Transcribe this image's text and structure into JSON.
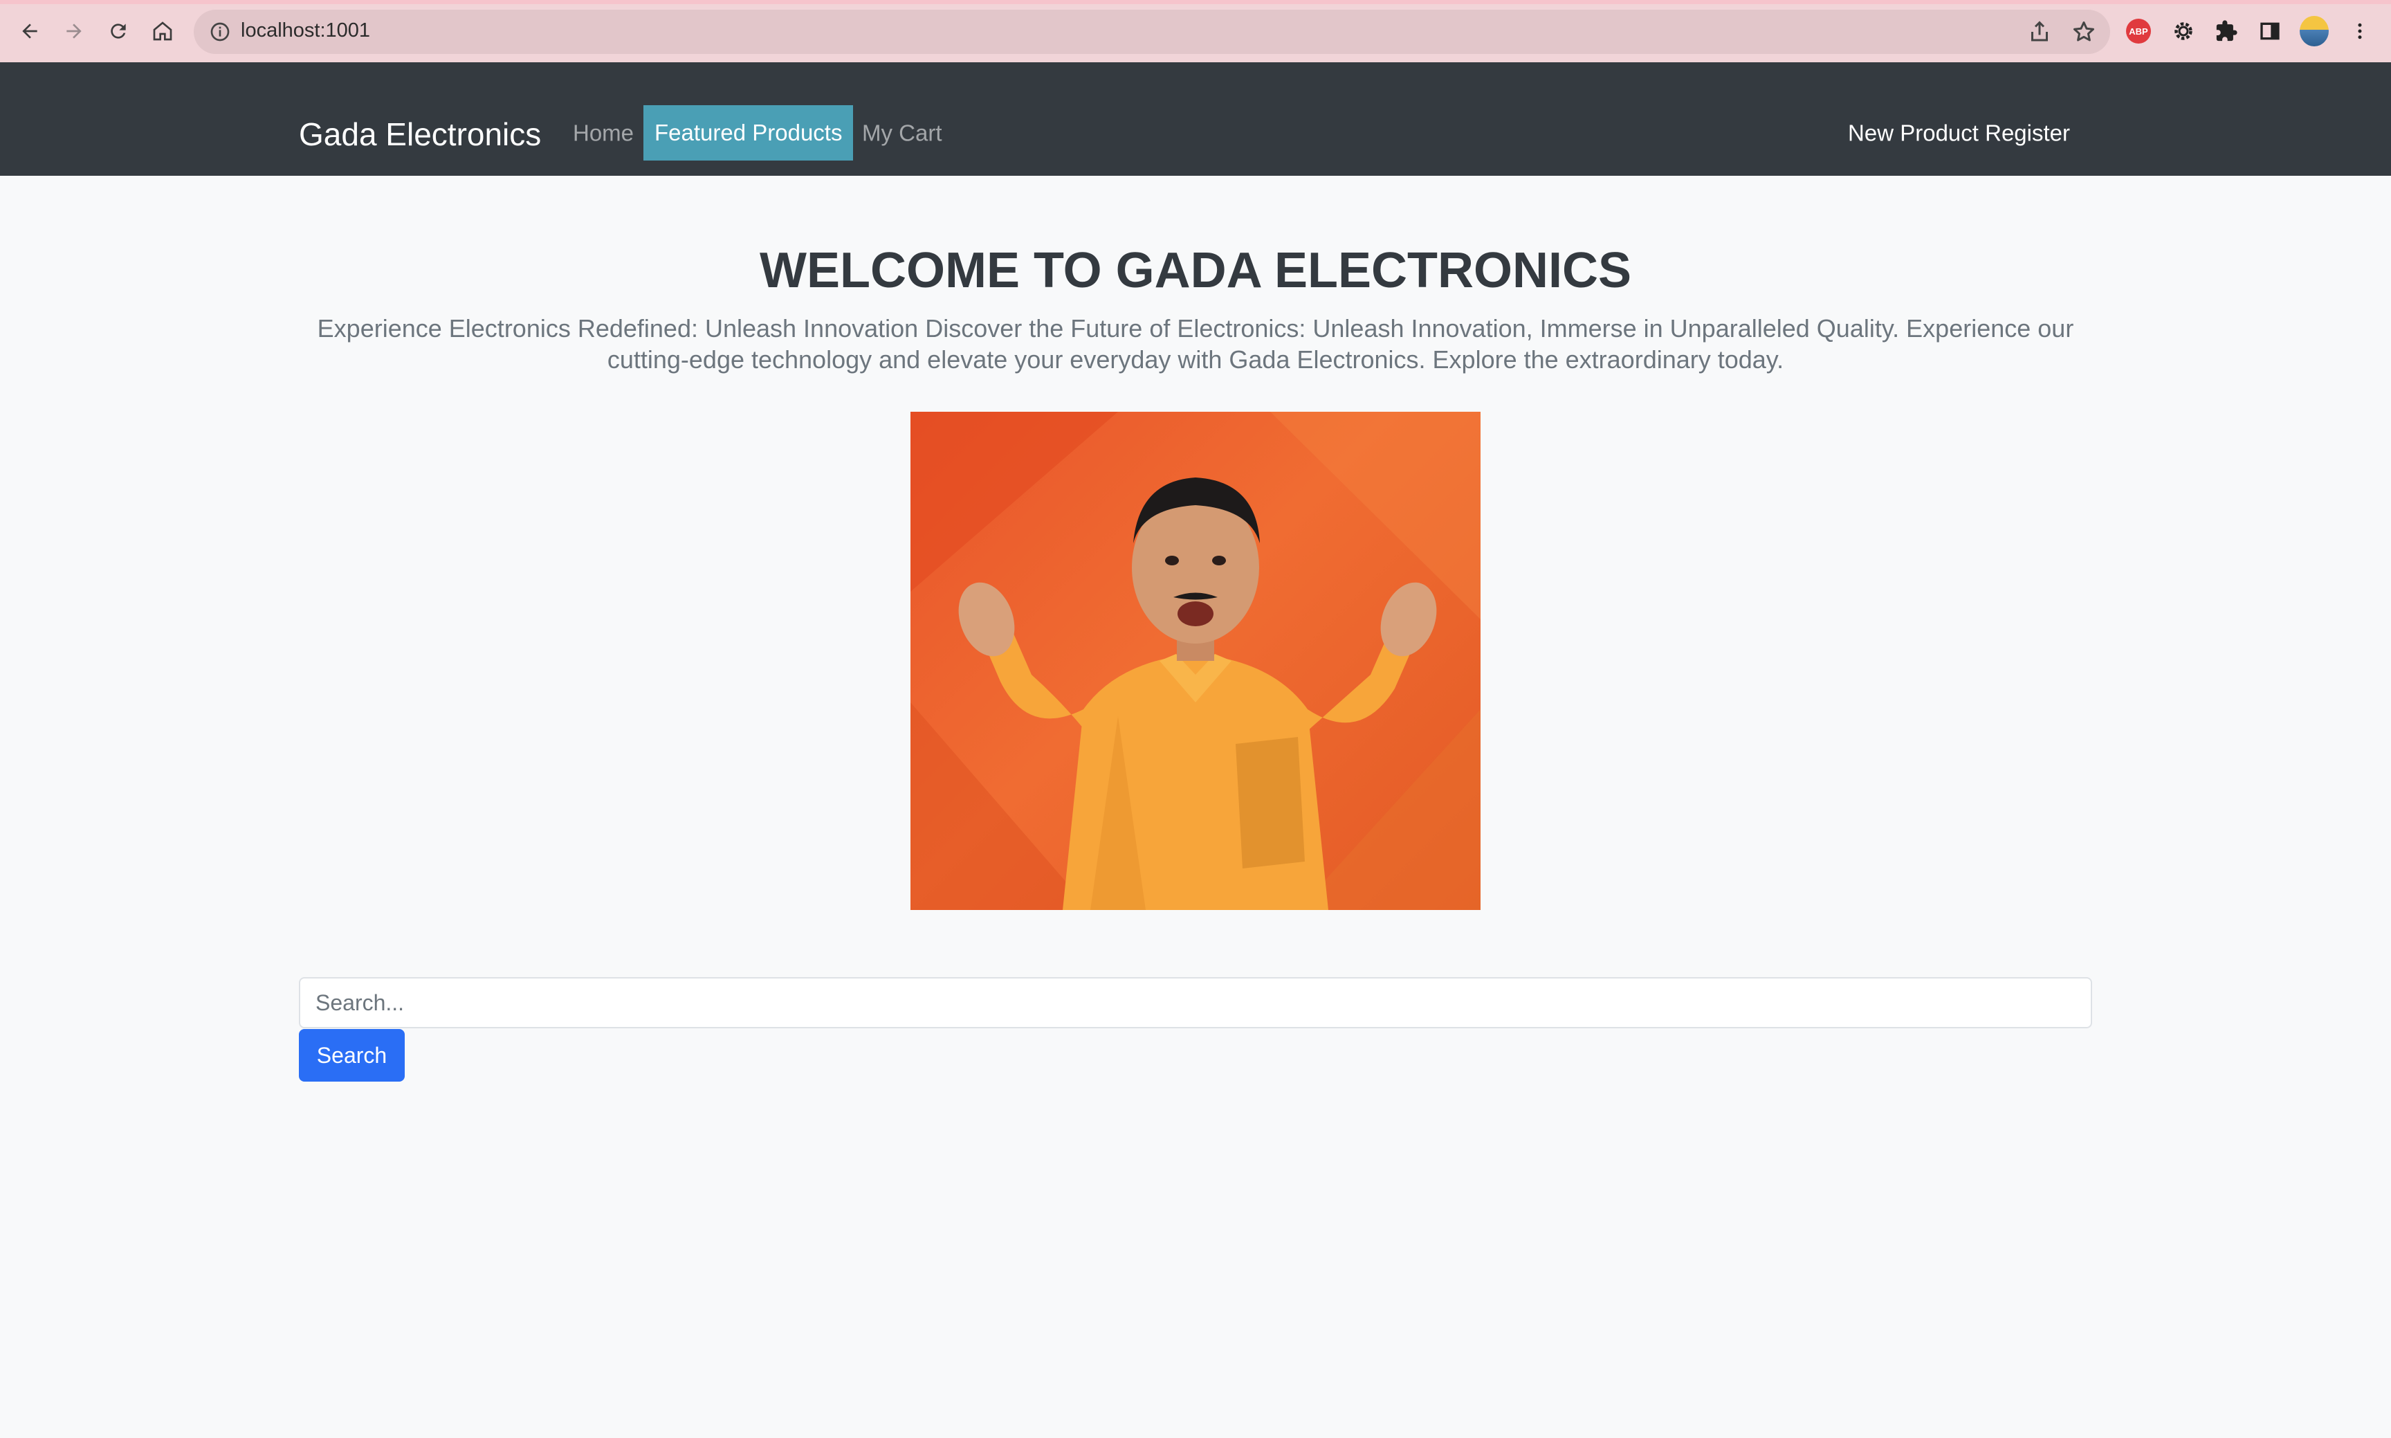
{
  "browser": {
    "url": "localhost:1001",
    "icons": [
      "back-arrow-icon",
      "forward-arrow-icon",
      "reload-icon",
      "home-icon",
      "info-icon",
      "share-icon",
      "star-icon",
      "adblock-icon",
      "extension-gear-icon",
      "puzzle-icon",
      "sidebar-icon",
      "profile-avatar",
      "kebab-menu-icon"
    ],
    "abp_label": "ABP"
  },
  "navbar": {
    "brand": "Gada Electronics",
    "links": [
      {
        "label": "Home"
      },
      {
        "label": "Featured Products"
      },
      {
        "label": "My Cart"
      }
    ],
    "right_link": "New Product Register"
  },
  "hero": {
    "title": "WELCOME TO GADA ELECTRONICS",
    "subtitle": "Experience Electronics Redefined: Unleash Innovation Discover the Future of Electronics: Unleash Innovation, Immerse in Unparalleled Quality. Experience our cutting-edge technology and elevate your everyday with Gada Electronics. Explore the extraordinary today."
  },
  "search": {
    "placeholder": "Search...",
    "value": "",
    "button_label": "Search"
  },
  "colors": {
    "navbar_bg": "#343a40",
    "active_tab_bg": "#4a9fb5",
    "primary_button": "#2a6ef5",
    "page_bg": "#f8f9fa",
    "browser_bar": "#f1d4d8"
  }
}
